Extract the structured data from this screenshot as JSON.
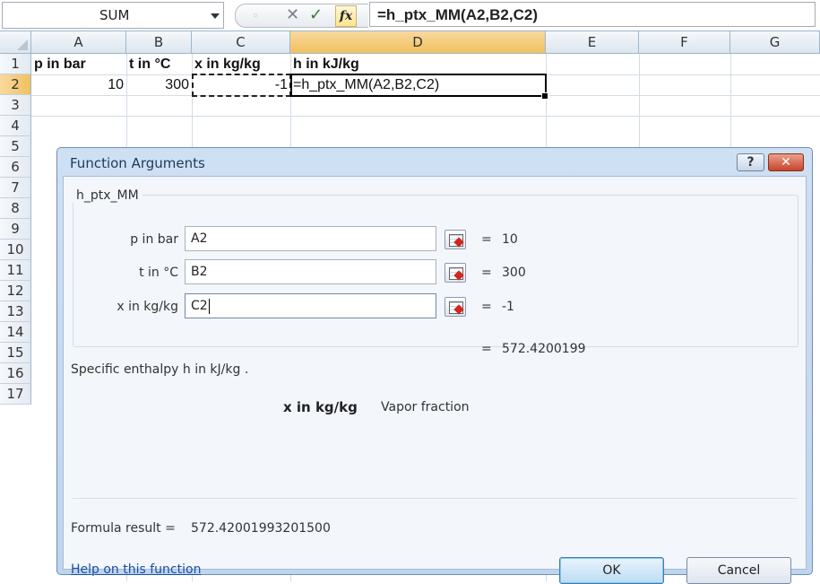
{
  "formula_bar": {
    "name_box": "SUM",
    "cancel_glyph": "✕",
    "enter_glyph": "✓",
    "fx_label": "fx",
    "formula": "=h_ptx_MM(A2,B2,C2)"
  },
  "sheet": {
    "columns": [
      "A",
      "B",
      "C",
      "D",
      "E",
      "F",
      "G"
    ],
    "rows": [
      "1",
      "2",
      "3",
      "4",
      "5",
      "6",
      "7",
      "8",
      "9",
      "10",
      "11",
      "12",
      "13",
      "14",
      "15",
      "16",
      "17"
    ],
    "row1": {
      "A": "p in bar",
      "B": "t in °C",
      "C": "x in kg/kg",
      "D": "h in kJ/kg"
    },
    "row2": {
      "A": "10",
      "B": "300",
      "C": "-1",
      "D": "=h_ptx_MM(A2,B2,C2)"
    }
  },
  "dialog": {
    "title": "Function Arguments",
    "help_glyph": "?",
    "close_glyph": "✕",
    "function_name": "h_ptx_MM",
    "args": [
      {
        "label": "p in bar",
        "value": "A2",
        "result": "10"
      },
      {
        "label": "t in °C",
        "value": "B2",
        "result": "300"
      },
      {
        "label": "x in kg/kg",
        "value": "C2",
        "result": "-1"
      }
    ],
    "equals": "=",
    "total_result": "572.4200199",
    "function_description": "Specific enthalpy h in kJ/kg .",
    "arg_help_name": "x in kg/kg",
    "arg_help_text": "Vapor fraction",
    "formula_result_label": "Formula result =",
    "formula_result_value": "572.42001993201500",
    "help_link": "Help on this function",
    "ok_label": "OK",
    "cancel_label": "Cancel"
  },
  "icons": {
    "collapse": "collapse-dialog-icon",
    "dropdown": "dropdown-arrow-icon",
    "fx": "insert-function-icon"
  }
}
